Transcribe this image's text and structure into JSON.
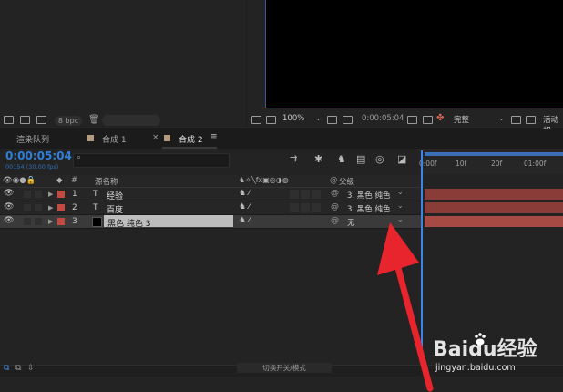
{
  "project": {
    "bpc": "8 bpc"
  },
  "viewer": {
    "zoom": "100%",
    "timecode": "0:00:05:04",
    "quality": "完整",
    "view": "活动相"
  },
  "tabs": [
    {
      "label": "渲染队列"
    },
    {
      "label": "合成 1"
    },
    {
      "label": "合成 2"
    }
  ],
  "timeline": {
    "timecode": "0:00:05:04",
    "frames": "00154 (30.00 fps)",
    "search_placeholder": "",
    "columns": {
      "source_name": "源名称",
      "parent": "父级"
    },
    "rows": [
      {
        "index": "1",
        "type": "T",
        "name": "经验",
        "parent": "3. 黑色 纯色"
      },
      {
        "index": "2",
        "type": "T",
        "name": "百度",
        "parent": "3. 黑色 纯色"
      },
      {
        "index": "3",
        "type": "",
        "name": "黑色 纯色 3",
        "parent": "无"
      }
    ],
    "ruler_labels": [
      "0:00f",
      "10f",
      "20f",
      "01:00f"
    ],
    "toggle_label": "切换开关/模式"
  },
  "watermark": {
    "logo": "Baidu经验",
    "url": "jingyan.baidu.com"
  },
  "colors": {
    "accent": "#2e7fd9",
    "label_red": "#c24a3e",
    "track": "#8a3d38",
    "arrow": "#e8242c"
  }
}
